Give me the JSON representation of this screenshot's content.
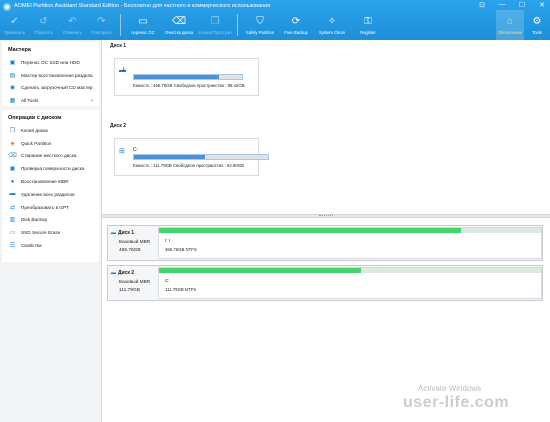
{
  "window": {
    "title": "AOMEI Partition Assistant Standard Edition - Бесплатно для частного и коммерческого использования",
    "controls": [
      "⊡",
      "—",
      "☐",
      "✕"
    ]
  },
  "toolbar": {
    "items": [
      {
        "label": "Применить",
        "icon": "check-icon"
      },
      {
        "label": "Сбросить",
        "icon": "reset-icon"
      },
      {
        "label": "Отменить",
        "icon": "undo-icon"
      },
      {
        "label": "Повторить",
        "icon": "redo-icon"
      },
      {
        "label": "перенос ОС",
        "icon": "migrate-os-icon"
      },
      {
        "label": "Очистка диска",
        "icon": "wipe-disk-icon"
      },
      {
        "label": "клонир Простран",
        "icon": "clone-icon"
      },
      {
        "label": "Safely Partition",
        "icon": "shield-icon"
      },
      {
        "label": "Free Backup",
        "icon": "backup-icon"
      },
      {
        "label": "System Clean",
        "icon": "clean-icon"
      },
      {
        "label": "Register",
        "icon": "register-icon"
      }
    ],
    "right": [
      {
        "label": "Обновление",
        "icon": "home-icon"
      },
      {
        "label": "Tools",
        "icon": "gear-icon"
      }
    ]
  },
  "sidebar": {
    "wizard": {
      "title": "Мастера",
      "items": [
        {
          "label": "Перенос ОС SSD или HDD"
        },
        {
          "label": "Мастер восстановления раздела"
        },
        {
          "label": "Сделать загрузочный CD мастер"
        },
        {
          "label": "All Tools",
          "arrow": "›"
        }
      ]
    },
    "operations": {
      "title": "Операции с диском",
      "items": [
        {
          "label": "Копия диска"
        },
        {
          "label": "Quick Partition"
        },
        {
          "label": "Стирание жесткого диска"
        },
        {
          "label": "Проверка поверхности диска"
        },
        {
          "label": "Восстановление MBR"
        },
        {
          "label": "Удаление всех разделов"
        },
        {
          "label": "Преобразовать в GPT"
        },
        {
          "label": "Disk Backup"
        },
        {
          "label": "SSD Secure Erase"
        },
        {
          "label": "Свойства"
        }
      ]
    }
  },
  "disks": [
    {
      "label": "Диск 1",
      "volume": "I:",
      "info": "Емкость : 465.76GB   Свободное пространство : 98.42GB",
      "used_fraction": 0.79
    },
    {
      "label": "Диск 2",
      "volume": "C:",
      "info": "Емкость : 111.79GB   Свободное пространство : 52.80GB",
      "used_fraction": 0.53
    }
  ],
  "disk_rows": [
    {
      "title": "Диск 1",
      "type": "Базовый MBR",
      "size": "465.76GB",
      "part_name": "I: I",
      "part_info": "465.76GB NTFS",
      "used_fraction": 0.79
    },
    {
      "title": "Диск 2",
      "type": "Базовый MBR",
      "size": "111.79GB",
      "part_name": "C:",
      "part_info": "111.79GB NTFS",
      "used_fraction": 0.53
    }
  ],
  "watermark": {
    "line1": "Activate Windows",
    "line2": "user-life.com"
  }
}
